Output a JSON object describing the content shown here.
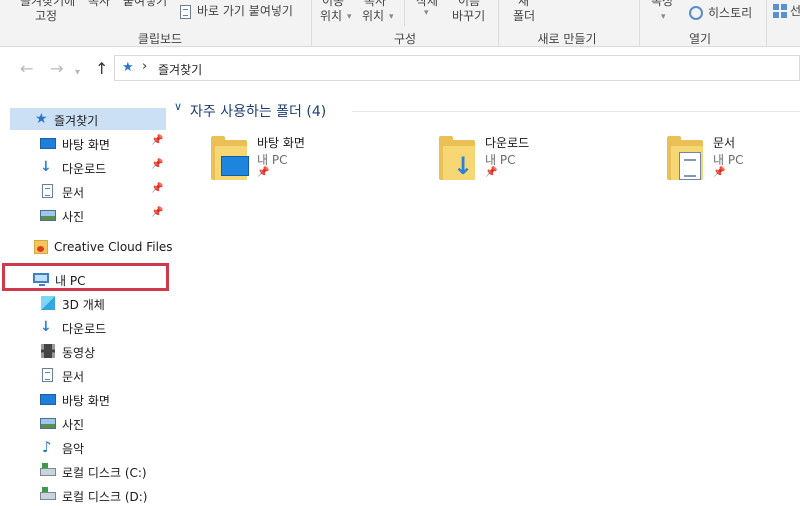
{
  "ribbon": {
    "clipboard": {
      "pin_quick_access_label": "즐겨찾기에",
      "pin_quick_access_label2": "고정",
      "copy_label": "복사",
      "paste_label": "붙여넣기",
      "paste_shortcut_label": "바로 가기 붙여넣기",
      "group_label": "클립보드"
    },
    "organize": {
      "move_to_label": "이동",
      "move_to_label2": "위치",
      "copy_to_label": "복사",
      "copy_to_label2": "위치",
      "delete_label": "삭제",
      "rename_label": "이름",
      "rename_label2": "바꾸기",
      "group_label": "구성"
    },
    "new": {
      "new_folder_label": "새",
      "new_folder_label2": "폴더",
      "group_label": "새로 만들기"
    },
    "open": {
      "properties_label": "속성",
      "history_label": "히스토리",
      "group_label": "열기"
    },
    "select": {
      "select_label": "선"
    }
  },
  "address": {
    "breadcrumb": "즐겨찾기"
  },
  "sidebar": {
    "quick_access": "즐겨찾기",
    "pinned": [
      {
        "label": "바탕 화면"
      },
      {
        "label": "다운로드"
      },
      {
        "label": "문서"
      },
      {
        "label": "사진"
      }
    ],
    "creative_cloud": "Creative Cloud Files",
    "this_pc": "내 PC",
    "pc_items": [
      {
        "label": "3D 개체"
      },
      {
        "label": "다운로드"
      },
      {
        "label": "동영상"
      },
      {
        "label": "문서"
      },
      {
        "label": "바탕 화면"
      },
      {
        "label": "사진"
      },
      {
        "label": "음악"
      },
      {
        "label": "로컬 디스크 (C:)"
      },
      {
        "label": "로컬 디스크 (D:)"
      }
    ]
  },
  "main": {
    "section_title": "자주 사용하는 폴더 (4)",
    "folders": [
      {
        "name": "바탕 화면",
        "location": "내 PC"
      },
      {
        "name": "다운로드",
        "location": "내 PC"
      },
      {
        "name": "문서",
        "location": "내 PC"
      }
    ]
  },
  "colors": {
    "highlight_box": "#d0384b",
    "selected_bg": "#cce0f5",
    "accent": "#2a76c8"
  }
}
